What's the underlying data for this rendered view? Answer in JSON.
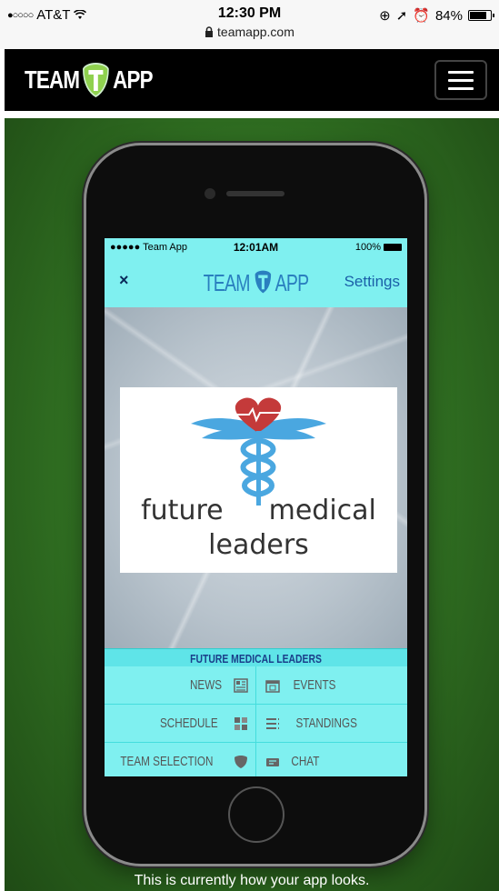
{
  "status_bar": {
    "carrier": "AT&T",
    "signal": "●○○○○",
    "time": "12:30 PM",
    "url": "teamapp.com",
    "battery": "84%",
    "battery_level": 0.84
  },
  "header": {
    "brand_left": "TEAM",
    "brand_right": "APP"
  },
  "phone_app": {
    "status": {
      "carrier": "●●●●● Team App",
      "time": "12:01AM",
      "battery": "100%"
    },
    "nav": {
      "close": "×",
      "brand_left": "TEAM",
      "brand_right": "APP",
      "settings": "Settings"
    },
    "logo": {
      "line1_left": "future",
      "line1_right": "medical",
      "line2": "leaders"
    },
    "club_title": "FUTURE MEDICAL LEADERS",
    "menu": [
      {
        "left": "NEWS",
        "left_icon": "news-icon",
        "right": "EVENTS",
        "right_icon": "calendar-icon"
      },
      {
        "left": "SCHEDULE",
        "left_icon": "schedule-icon",
        "right": "STANDINGS",
        "right_icon": "list-icon"
      },
      {
        "left": "TEAM SELECTION",
        "left_icon": "shield-icon",
        "right": "CHAT",
        "right_icon": "chat-icon"
      }
    ]
  },
  "caption": "This is currently how your app looks.",
  "colors": {
    "accent": "#7ff0f0",
    "brand_blue": "#2a7fbf",
    "background_green": "#2f6d21"
  }
}
